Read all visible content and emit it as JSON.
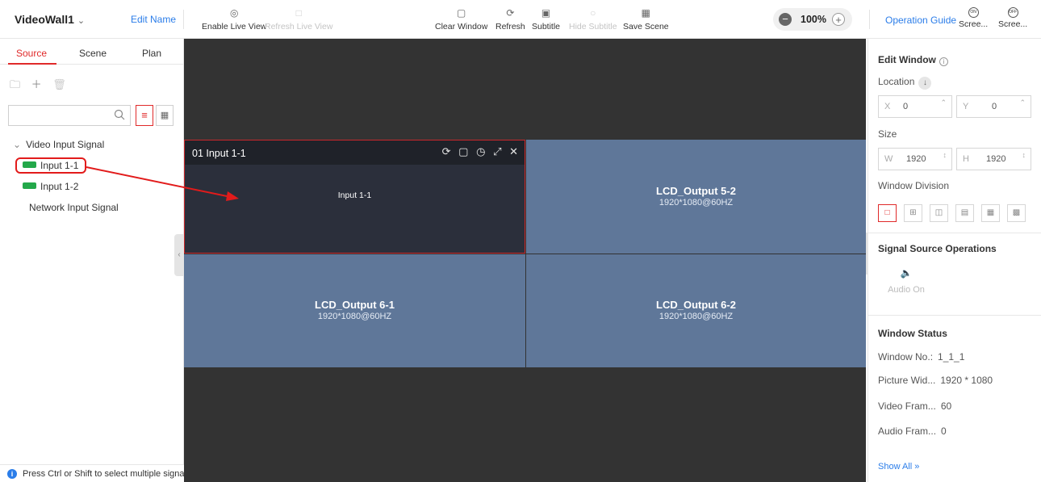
{
  "top": {
    "wall_name": "VideoWall1",
    "edit_name": "Edit Name",
    "enable_live_view": "Enable Live View",
    "refresh_live_view": "Refresh Live View",
    "clear_window": "Clear Window",
    "refresh": "Refresh",
    "subtitle": "Subtitle",
    "hide_subtitle": "Hide Subtitle",
    "save_scene": "Save Scene",
    "zoom": "100%",
    "operation_guide": "Operation Guide",
    "screen_on": "Scree...",
    "screen_off": "Scree...",
    "screen_on_icon_text": "ON",
    "screen_off_icon_text": "OFF"
  },
  "left": {
    "tabs": [
      "Source",
      "Scene",
      "Plan"
    ],
    "active_tab": "Source",
    "search": {
      "value": "",
      "placeholder": ""
    },
    "tree": {
      "group": "Video Input Signal",
      "items": [
        "Input 1-1",
        "Input 1-2"
      ],
      "network": "Network Input Signal"
    },
    "hint": "Press Ctrl or Shift to select multiple signa..."
  },
  "canvas": {
    "window": {
      "title": "01  Input 1-1",
      "label": "Input 1-1"
    },
    "screens": [
      {
        "name": "LCD_Output 5-2",
        "res": "1920*1080@60HZ"
      },
      {
        "name": "LCD_Output 6-1",
        "res": "1920*1080@60HZ"
      },
      {
        "name": "LCD_Output 6-2",
        "res": "1920*1080@60HZ"
      }
    ]
  },
  "right": {
    "edit_window": "Edit Window",
    "location": "Location",
    "x_label": "X",
    "x_value": "0",
    "y_label": "Y",
    "y_value": "0",
    "size": "Size",
    "w_label": "W",
    "w_value": "1920",
    "h_label": "H",
    "h_value": "1920",
    "window_division": "Window Division",
    "signal_ops": "Signal Source Operations",
    "audio_on": "Audio On",
    "window_status": "Window Status",
    "status": [
      {
        "label": "Window No.:",
        "value": "1_1_1"
      },
      {
        "label": "Picture Wid...",
        "value": "1920 * 1080"
      },
      {
        "label": "Video Fram...",
        "value": "60"
      },
      {
        "label": "Audio Fram...",
        "value": "0"
      }
    ],
    "show_all": "Show All »"
  },
  "colors": {
    "accent_red": "#e02a2a",
    "link_blue": "#2b7de9",
    "signal_green": "#23a84a",
    "screen_blue": "#5f7799",
    "canvas_dark": "#333333"
  }
}
